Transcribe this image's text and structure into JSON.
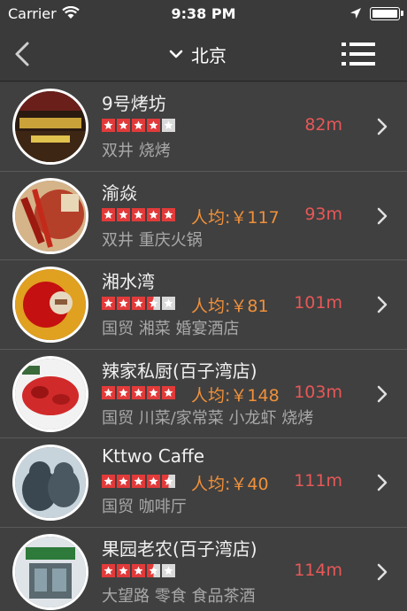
{
  "status_bar": {
    "carrier": "Carrier",
    "time": "9:38 PM"
  },
  "nav": {
    "city": "北京",
    "back_icon": "chevron-left-icon",
    "dropdown_icon": "chevron-down-icon",
    "menu_icon": "list-menu-icon"
  },
  "colors": {
    "background": "#3a3a3a",
    "row_bg": "#404040",
    "star_on": "#e23a3a",
    "star_off": "#d9d9d9",
    "price": "#f0903a",
    "distance": "#e85757",
    "tags": "#a8a8a8"
  },
  "restaurants": [
    {
      "name": "9号烤坊",
      "rating": 4,
      "avg_price": "",
      "distance": "82m",
      "tags": "双井 烧烤"
    },
    {
      "name": "渝焱",
      "rating": 5,
      "avg_price": "人均:￥117",
      "distance": "93m",
      "tags": "双井 重庆火锅"
    },
    {
      "name": "湘水湾",
      "rating": 3.5,
      "avg_price": "人均:￥81",
      "distance": "101m",
      "tags": "国贸 湘菜 婚宴酒店"
    },
    {
      "name": "辣家私厨(百子湾店)",
      "rating": 5,
      "avg_price": "人均:￥148",
      "distance": "103m",
      "tags": "国贸 川菜/家常菜 小龙虾 烧烤"
    },
    {
      "name": "Kttwo Caffe",
      "rating": 4.5,
      "avg_price": "人均:￥40",
      "distance": "111m",
      "tags": "国贸 咖啡厅"
    },
    {
      "name": "果园老农(百子湾店)",
      "rating": 3.5,
      "avg_price": "",
      "distance": "114m",
      "tags": "大望路 零食 食品茶酒"
    }
  ]
}
